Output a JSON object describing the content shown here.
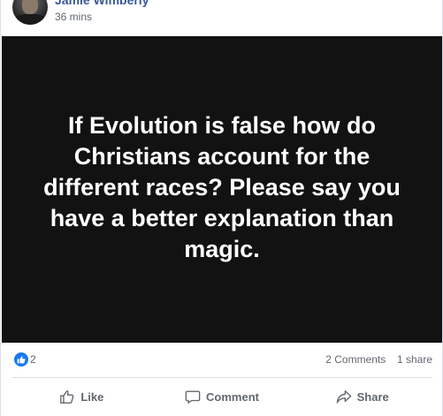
{
  "post": {
    "author": "Jamie Wimberly",
    "timestamp": "36 mins",
    "image_text": "If Evolution is false how do Christians account for the different races? Please say you have a better explanation than magic."
  },
  "stats": {
    "like_count": "2",
    "comments": "2 Comments",
    "shares": "1 share"
  },
  "actions": {
    "like": "Like",
    "comment": "Comment",
    "share": "Share"
  },
  "icons": {
    "reaction": "like-thumb-icon",
    "like": "thumbs-up-icon",
    "comment": "speech-bubble-icon",
    "share": "share-arrow-icon"
  },
  "colors": {
    "author_link": "#385898",
    "like_blue": "#1877f2",
    "image_background": "#121212",
    "muted_text": "#606770"
  }
}
